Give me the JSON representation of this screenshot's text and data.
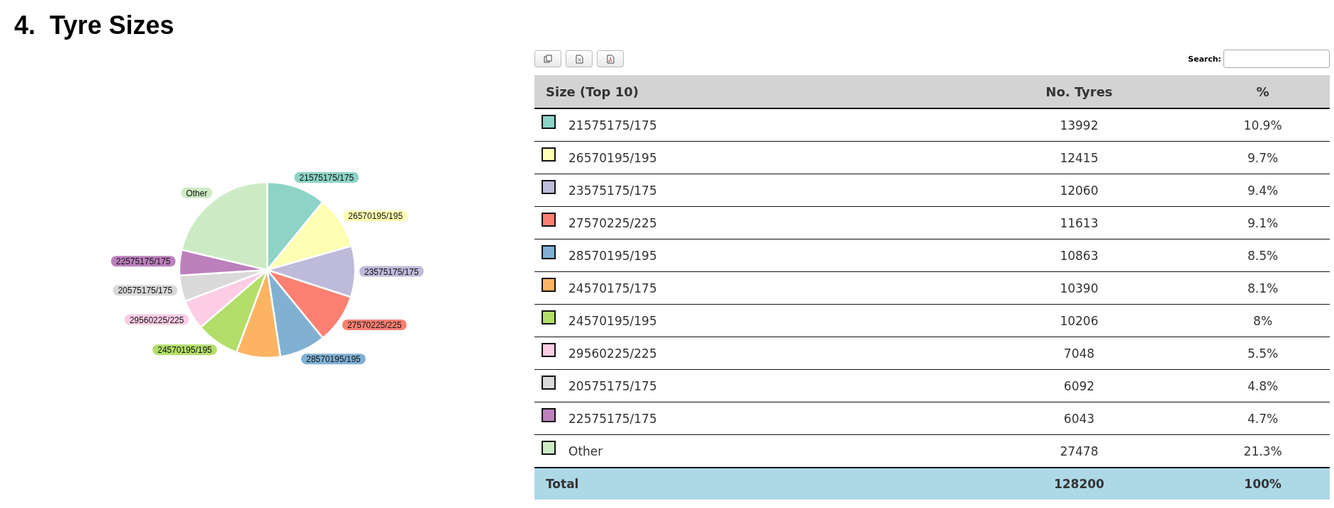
{
  "heading": "4.  Tyre Sizes",
  "pie": {
    "chart_data": {
      "type": "pie",
      "categories": [
        "21575175/175",
        "26570195/195",
        "23575175/175",
        "27570225/225",
        "28570195/195",
        null,
        "24570195/195",
        "29560225/225",
        "20575175/175",
        "22575175/175",
        "Other"
      ],
      "values": [
        10.9,
        9.7,
        9.4,
        9.1,
        8.5,
        8.1,
        8,
        5.5,
        4.8,
        4.7,
        21.3
      ]
    }
  },
  "toolbar": [
    {
      "kind": "copy"
    },
    {
      "kind": "excel"
    },
    {
      "kind": "pdf"
    }
  ],
  "search": {
    "label": "Search:"
  },
  "table": {
    "columns": [
      "Size (Top 10)",
      "No. Tyres",
      "%"
    ],
    "rows": [
      {
        "color": "#8dd3c7",
        "size": "21575175/175",
        "count": "13992",
        "pct": "10.9%"
      },
      {
        "color": "#ffffb3",
        "size": "26570195/195",
        "count": "12415",
        "pct": "9.7%"
      },
      {
        "color": "#bebada",
        "size": "23575175/175",
        "count": "12060",
        "pct": "9.4%"
      },
      {
        "color": "#fb8072",
        "size": "27570225/225",
        "count": "11613",
        "pct": "9.1%"
      },
      {
        "color": "#80b1d3",
        "size": "28570195/195",
        "count": "10863",
        "pct": "8.5%"
      },
      {
        "color": "#fdb462",
        "size": "24570175/175",
        "count": "10390",
        "pct": "8.1%"
      },
      {
        "color": "#b3de69",
        "size": "24570195/195",
        "count": "10206",
        "pct": "8%"
      },
      {
        "color": "#fccde5",
        "size": "29560225/225",
        "count": "7048",
        "pct": "5.5%"
      },
      {
        "color": "#d9d9d9",
        "size": "20575175/175",
        "count": "6092",
        "pct": "4.8%"
      },
      {
        "color": "#bc80bd",
        "size": "22575175/175",
        "count": "6043",
        "pct": "4.7%"
      },
      {
        "color": "#ccebc5",
        "size": "Other",
        "count": "27478",
        "pct": "21.3%"
      }
    ],
    "total": {
      "label": "Total",
      "count": "128200",
      "pct": "100%"
    }
  }
}
